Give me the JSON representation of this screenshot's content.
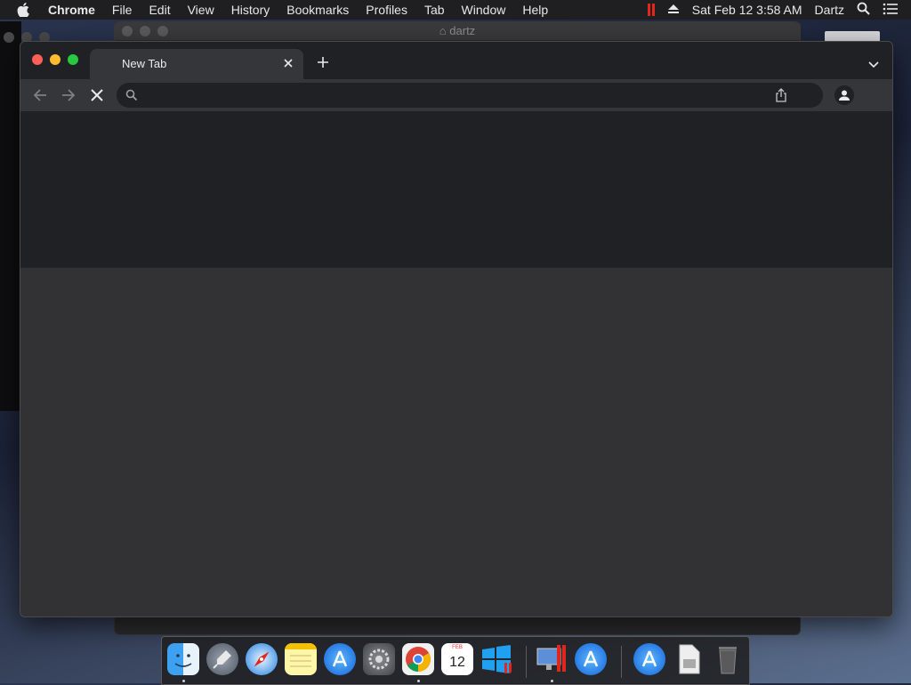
{
  "menubar": {
    "app_name": "Chrome",
    "items": [
      "File",
      "Edit",
      "View",
      "History",
      "Bookmarks",
      "Profiles",
      "Tab",
      "Window",
      "Help"
    ],
    "clock": "Sat Feb 12  3:58 AM",
    "user": "Dartz"
  },
  "background_window": {
    "title": "dartz"
  },
  "browser": {
    "tab": {
      "title": "New Tab"
    },
    "omnibox": {
      "value": "",
      "placeholder": ""
    },
    "colors": {
      "tab_strip": "#202124",
      "toolbar": "#35363a",
      "content_top": "#202124",
      "content_bottom": "#323234"
    }
  },
  "dock": {
    "calendar": {
      "month": "FEB",
      "day": "12"
    },
    "apps": [
      "finder-icon",
      "launchpad-icon",
      "safari-icon",
      "notes-icon",
      "app-store-icon",
      "system-preferences-icon",
      "chrome-icon",
      "calendar-icon",
      "windows-icon",
      "parallels-icon",
      "app-store-2-icon",
      "app-store-3-icon",
      "document-icon",
      "trash-icon"
    ]
  }
}
